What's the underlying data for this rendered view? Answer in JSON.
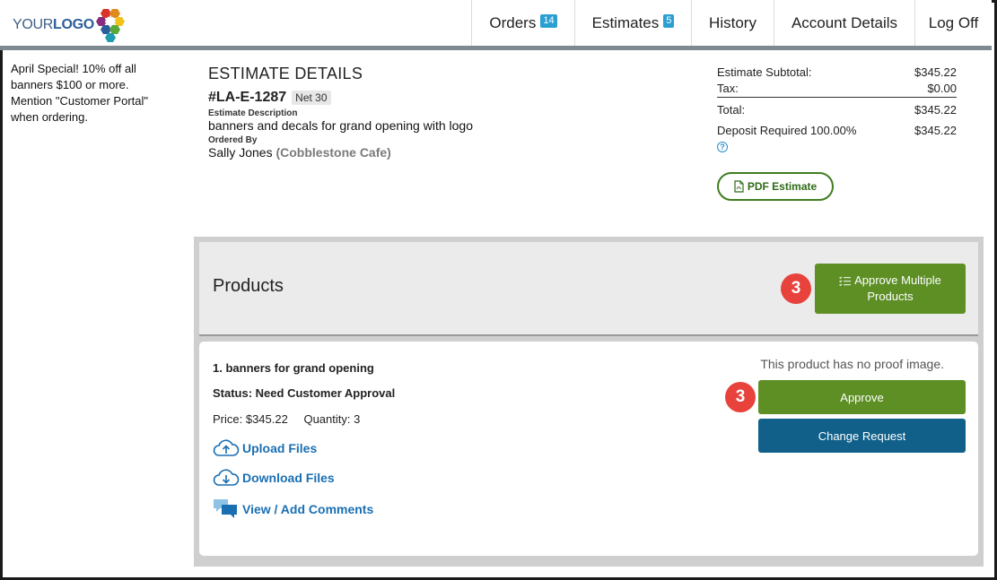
{
  "header": {
    "logo_your": "YOUR",
    "logo_logo": "LOGO",
    "nav": [
      {
        "label": "Orders",
        "badge": "14"
      },
      {
        "label": "Estimates",
        "badge": "5"
      },
      {
        "label": "History"
      },
      {
        "label": "Account Details"
      },
      {
        "label": "Log Off"
      }
    ],
    "active_tab": "Estimates"
  },
  "sidebar": {
    "promo": "April Special! 10% off all banners $100 or more. Mention \"Customer Portal\" when ordering."
  },
  "estimate": {
    "section_title": "ESTIMATE DETAILS",
    "number": "#LA-E-1287",
    "terms": "Net 30",
    "description_label": "Estimate Description",
    "description": "banners and decals for grand opening with logo",
    "ordered_by_label": "Ordered By",
    "ordered_by_name": "Sally Jones",
    "company": "(Cobblestone Cafe)"
  },
  "totals": {
    "subtotal_label": "Estimate Subtotal:",
    "subtotal": "$345.22",
    "tax_label": "Tax:",
    "tax": "$0.00",
    "total_label": "Total:",
    "total": "$345.22",
    "deposit_label": "Deposit Required 100.00%",
    "deposit": "$345.22",
    "help": "?",
    "pdf_button": "PDF Estimate"
  },
  "products": {
    "title": "Products",
    "step_badge": "3",
    "approve_multiple_line1": "Approve Multiple",
    "approve_multiple_line2": "Products",
    "items": [
      {
        "title": "1.  banners for grand opening",
        "status": "Status: Need Customer Approval",
        "price": "Price: $345.22",
        "quantity": "Quantity: 3",
        "no_proof": "This product has no proof image.",
        "step_badge": "3",
        "approve": "Approve",
        "change_request": "Change Request",
        "upload": "Upload Files",
        "download": "Download Files",
        "comments": "View / Add Comments"
      }
    ]
  },
  "colors": {
    "primary_green": "#5d8f25",
    "accent_green": "#63b22f",
    "blue_button": "#106089",
    "link_blue": "#1a6fb3",
    "badge_blue": "#2aa0d2",
    "step_red": "#e8423c"
  }
}
